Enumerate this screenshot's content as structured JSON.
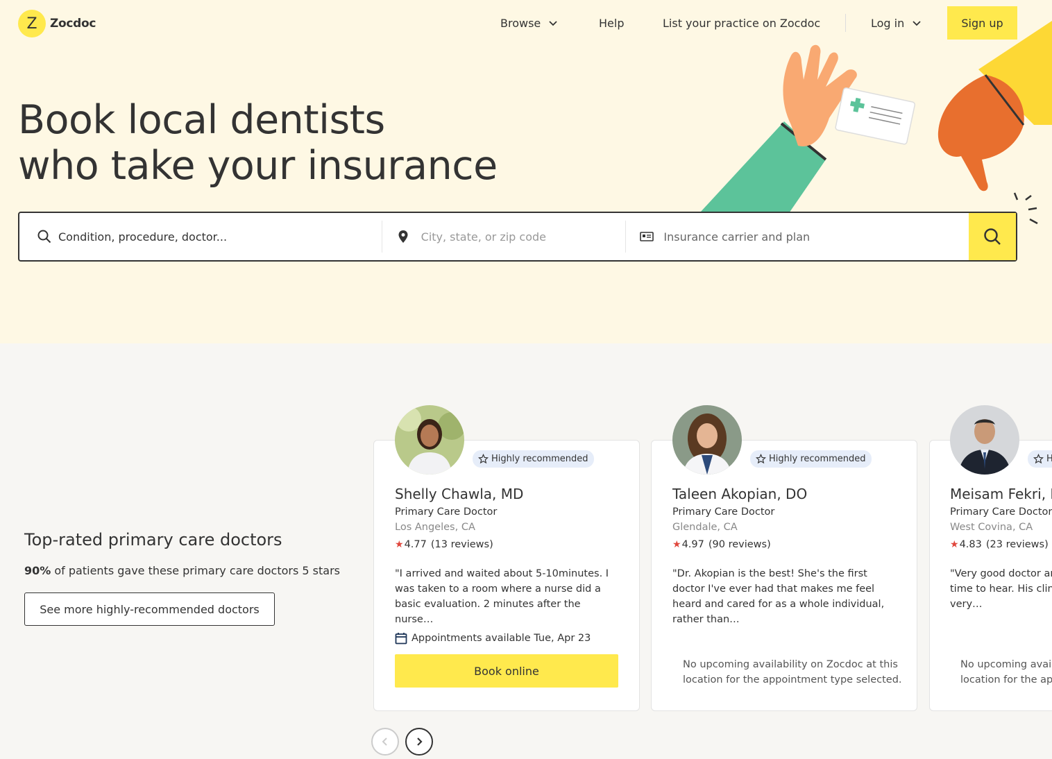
{
  "brand": {
    "name": "Zocdoc",
    "logo_glyph": "Z",
    "accent": "#ffe94d"
  },
  "nav": {
    "browse": "Browse",
    "help": "Help",
    "list_practice": "List your practice on Zocdoc",
    "login": "Log in",
    "signup": "Sign up"
  },
  "hero": {
    "line1": "Book local dentists",
    "line2": "who take your insurance"
  },
  "search": {
    "condition_placeholder": "Condition, procedure, doctor...",
    "location_placeholder": "City, state, or zip code",
    "insurance_placeholder": "Insurance carrier and plan"
  },
  "section": {
    "title": "Top-rated primary care doctors",
    "sub_bold": "90%",
    "sub_rest": " of patients gave these primary care doctors 5 stars",
    "more_button": "See more highly-recommended doctors"
  },
  "doctors": [
    {
      "badge": "Highly recommended",
      "name": "Shelly Chawla, MD",
      "specialty": "Primary Care Doctor",
      "location": "Los Angeles, CA",
      "rating": "4.77",
      "reviews": "(13 reviews)",
      "quote": "\"I arrived and waited about 5-10minutes. I was taken to a room where a nurse did a basic evaluation. 2 minutes after the nurse…",
      "appointments": "Appointments available Tue, Apr 23",
      "book": "Book online"
    },
    {
      "badge": "Highly recommended",
      "name": "Taleen Akopian, DO",
      "specialty": "Primary Care Doctor",
      "location": "Glendale, CA",
      "rating": "4.97",
      "reviews": "(90 reviews)",
      "quote": "\"Dr. Akopian is the best! She's the first doctor I've ever had that makes me feel heard and cared for as a whole individual, rather than…",
      "availability": "No upcoming availability on Zocdoc at this location for the appointment type selected."
    },
    {
      "badge": "Highly recommended",
      "name": "Meisam Fekri, MD",
      "specialty": "Primary Care Doctor",
      "location": "West Covina, CA",
      "rating": "4.83",
      "reviews": "(23 reviews)",
      "quote": "\"Very good doctor and takes maximum time to hear. His clinical diagnosis is very…",
      "availability": "No upcoming availability on Zocdoc at this location for the appointment type selected."
    }
  ],
  "icons": {
    "search": "search-icon",
    "location": "map-pin-icon",
    "insurance": "insurance-card-icon",
    "star": "star-icon",
    "calendar": "calendar-icon",
    "chevron": "chevron-down-icon"
  }
}
